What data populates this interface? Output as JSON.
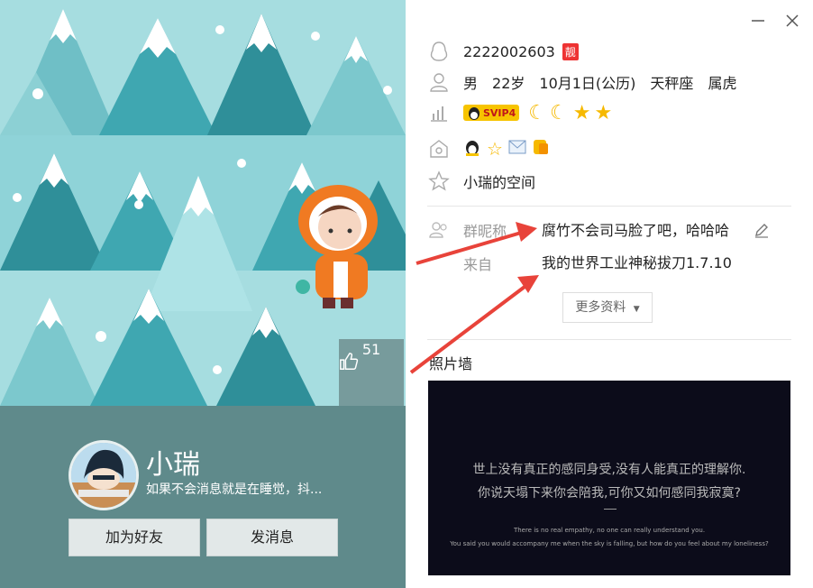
{
  "like": {
    "count": "51"
  },
  "profile": {
    "name": "小瑞",
    "signature": "如果不会消息就是在睡觉，抖..."
  },
  "buttons": {
    "add_friend": "加为好友",
    "send_message": "发消息"
  },
  "info": {
    "qq_number": "2222002603",
    "pretty_badge": "靓",
    "gender": "男",
    "age": "22岁",
    "birthday": "10月1日(公历)",
    "zodiac": "天秤座",
    "chinese_zodiac": "属虎",
    "vip_badge": "SVIP4",
    "space": "小瑞的空间"
  },
  "group": {
    "nickname_label": "群昵称",
    "nickname_value": "腐竹不会司马脸了吧，哈哈哈",
    "source_label": "来自",
    "source_value": "我的世界工业神秘拔刀1.7.10"
  },
  "more_info": "更多资料",
  "photo_wall": {
    "title": "照片墙",
    "line1": "世上没有真正的感同身受,没有人能真正的理解你.",
    "line2": "你说天塌下来你会陪我,可你又如何感同我寂寞?",
    "en1": "There is no real empathy, no one can really understand you.",
    "en2": "You said you would accompany me when the sky is falling, but how do you feel about my loneliness?"
  },
  "colors": {
    "cover_bg": "#a8dde0",
    "panel_bg": "#5f8a8b",
    "arrow": "#e8433a",
    "badge_red": "#e33333"
  }
}
